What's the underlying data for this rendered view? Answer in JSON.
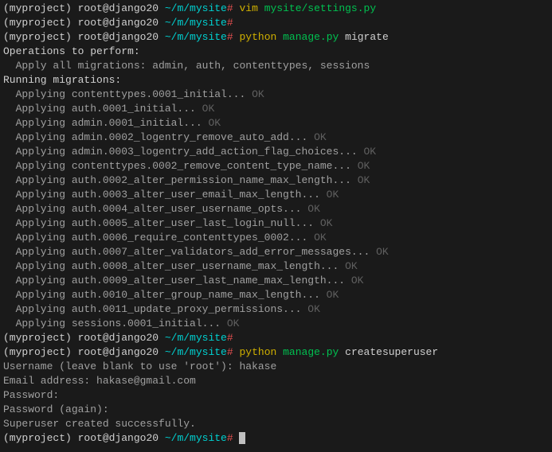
{
  "prompt": {
    "env": "(myproject) ",
    "user": "root@django20 ",
    "path": "~/m/mysite",
    "hash": "#"
  },
  "commands": {
    "vim": "vim",
    "vim_arg": "mysite/settings.py",
    "python": "python",
    "manage": "manage.py",
    "migrate": "migrate",
    "createsuperuser": "createsuperuser"
  },
  "migrate_output": {
    "header1": "Operations to perform:",
    "apply_all": "  Apply all migrations: admin, auth, contenttypes, sessions",
    "header2": "Running migrations:",
    "ok": "OK",
    "migrations": [
      "  Applying contenttypes.0001_initial... ",
      "  Applying auth.0001_initial... ",
      "  Applying admin.0001_initial... ",
      "  Applying admin.0002_logentry_remove_auto_add... ",
      "  Applying admin.0003_logentry_add_action_flag_choices... ",
      "  Applying contenttypes.0002_remove_content_type_name... ",
      "  Applying auth.0002_alter_permission_name_max_length... ",
      "  Applying auth.0003_alter_user_email_max_length... ",
      "  Applying auth.0004_alter_user_username_opts... ",
      "  Applying auth.0005_alter_user_last_login_null... ",
      "  Applying auth.0006_require_contenttypes_0002... ",
      "  Applying auth.0007_alter_validators_add_error_messages... ",
      "  Applying auth.0008_alter_user_username_max_length... ",
      "  Applying auth.0009_alter_user_last_name_max_length... ",
      "  Applying auth.0010_alter_group_name_max_length... ",
      "  Applying auth.0011_update_proxy_permissions... ",
      "  Applying sessions.0001_initial... "
    ]
  },
  "superuser": {
    "username_prompt": "Username (leave blank to use 'root'): hakase",
    "email_prompt": "Email address: hakase@gmail.com",
    "password_prompt": "Password:",
    "password_again": "Password (again):",
    "success": "Superuser created successfully."
  }
}
